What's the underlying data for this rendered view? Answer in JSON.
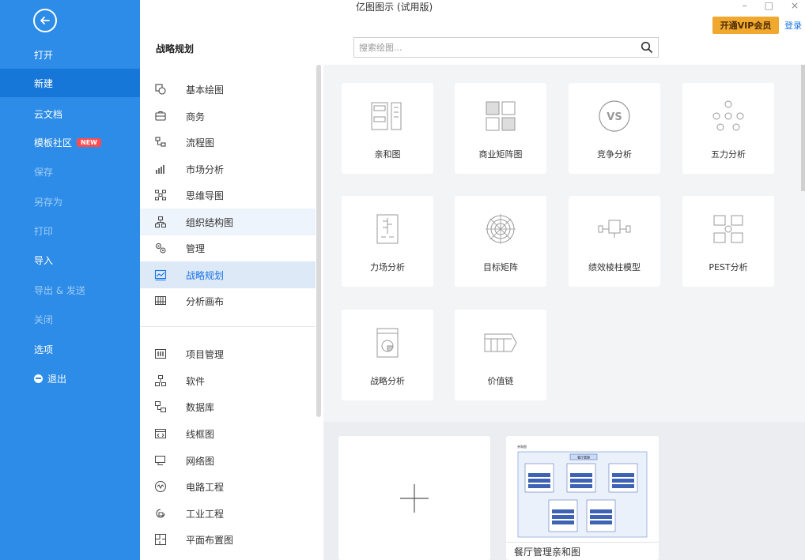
{
  "window": {
    "title": "亿图图示 (试用版)",
    "controls": [
      "–",
      "□",
      "×"
    ]
  },
  "header": {
    "vip_button": "开通VIP会员",
    "login_link": "登录",
    "section_title": "战略规划",
    "search_placeholder": "搜索绘图..."
  },
  "sidebar": {
    "back_icon": "arrow-left-icon",
    "items": [
      {
        "label": "打开",
        "state": "normal"
      },
      {
        "label": "新建",
        "state": "active"
      },
      {
        "label": "云文档",
        "state": "normal"
      },
      {
        "label": "模板社区",
        "badge": "NEW",
        "state": "normal"
      },
      {
        "label": "保存",
        "state": "dim"
      },
      {
        "label": "另存为",
        "state": "dim"
      },
      {
        "label": "打印",
        "state": "dim"
      },
      {
        "label": "导入",
        "state": "normal"
      },
      {
        "label": "导出 & 发送",
        "state": "dim"
      },
      {
        "label": "关闭",
        "state": "dim"
      },
      {
        "label": "选项",
        "state": "normal"
      },
      {
        "label": "退出",
        "state": "normal",
        "icon": "exit-icon"
      }
    ]
  },
  "categories": {
    "group1": [
      {
        "label": "基本绘图",
        "icon": "shapes-icon"
      },
      {
        "label": "商务",
        "icon": "briefcase-icon"
      },
      {
        "label": "流程图",
        "icon": "flowchart-icon"
      },
      {
        "label": "市场分析",
        "icon": "bar-chart-icon"
      },
      {
        "label": "思维导图",
        "icon": "mindmap-icon"
      },
      {
        "label": "组织结构图",
        "icon": "org-chart-icon",
        "state": "hover"
      },
      {
        "label": "管理",
        "icon": "gears-icon"
      },
      {
        "label": "战略规划",
        "icon": "strategy-icon",
        "state": "selected"
      },
      {
        "label": "分析画布",
        "icon": "canvas-icon"
      }
    ],
    "group2": [
      {
        "label": "项目管理",
        "icon": "gantt-icon"
      },
      {
        "label": "软件",
        "icon": "software-icon"
      },
      {
        "label": "数据库",
        "icon": "database-icon"
      },
      {
        "label": "线框图",
        "icon": "wireframe-icon"
      },
      {
        "label": "网络图",
        "icon": "network-icon"
      },
      {
        "label": "电路工程",
        "icon": "circuit-icon"
      },
      {
        "label": "工业工程",
        "icon": "industrial-icon"
      },
      {
        "label": "平面布置图",
        "icon": "floorplan-icon"
      }
    ]
  },
  "templates": [
    {
      "label": "亲和图",
      "icon": "affinity-diagram-icon"
    },
    {
      "label": "商业矩阵图",
      "icon": "business-matrix-icon"
    },
    {
      "label": "竞争分析",
      "icon": "vs-icon"
    },
    {
      "label": "五力分析",
      "icon": "five-forces-icon"
    },
    {
      "label": "力场分析",
      "icon": "force-field-icon"
    },
    {
      "label": "目标矩阵",
      "icon": "target-matrix-icon"
    },
    {
      "label": "绩效棱柱模型",
      "icon": "performance-prism-icon"
    },
    {
      "label": "PEST分析",
      "icon": "pest-icon"
    },
    {
      "label": "战略分析",
      "icon": "strategy-analysis-icon"
    },
    {
      "label": "价值链",
      "icon": "value-chain-icon"
    }
  ],
  "examples": {
    "new_blank_icon": "plus-icon",
    "sample": {
      "label": "餐厅管理亲和图",
      "thumb_corner": "亲和图",
      "thumb_header": "餐厅管理"
    }
  },
  "colors": {
    "sidebar": "#2d8ce8",
    "sidebar_active": "#1677d9",
    "vip": "#f0a82f",
    "accent": "#1a73e8",
    "badge": "#ff4d4f"
  }
}
